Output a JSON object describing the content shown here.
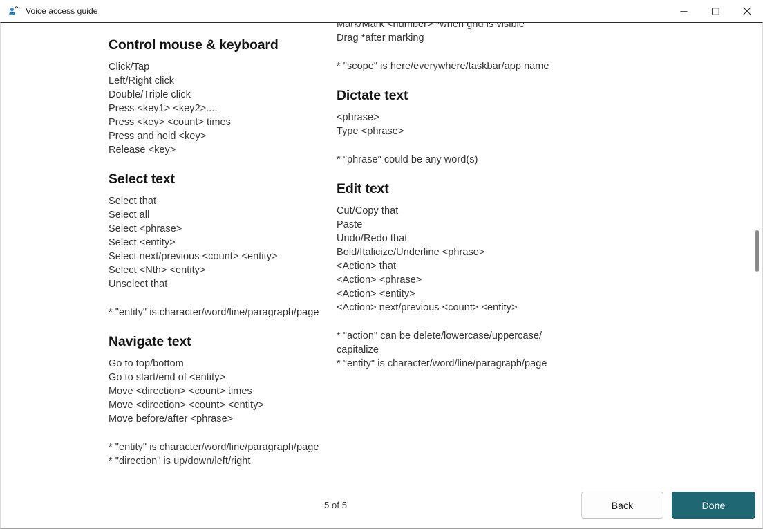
{
  "window": {
    "title": "Voice access guide",
    "icon": "voice-access-icon",
    "controls": {
      "minimize": "minimize-icon",
      "maximize": "maximize-icon",
      "close": "close-icon"
    }
  },
  "content": {
    "left_column": {
      "clipped_top_line": "",
      "sections": [
        {
          "heading": "Control mouse & keyboard",
          "items": [
            "Click/Tap",
            "Left/Right click",
            "Double/Triple click",
            "Press <key1> <key2>....",
            "Press <key> <count> times",
            "Press and hold <key>",
            "Release <key>"
          ],
          "notes": []
        },
        {
          "heading": "Select text",
          "items": [
            "Select that",
            "Select all",
            "Select <phrase>",
            "Select <entity>",
            "Select next/previous <count> <entity>",
            "Select <Nth> <entity>",
            "Unselect that"
          ],
          "notes": [
            "* \"entity\" is character/word/line/paragraph/page"
          ]
        },
        {
          "heading": "Navigate text",
          "items": [
            "Go to top/bottom",
            "Go to start/end of <entity>",
            "Move <direction> <count> times",
            "Move <direction> <count> <entity>",
            "Move before/after <phrase>"
          ],
          "notes": [
            "* \"entity\" is character/word/line/paragraph/page",
            "* \"direction\" is up/down/left/right"
          ]
        }
      ]
    },
    "right_column": {
      "clipped_top_line": "",
      "continued_items": [
        "Mark/Mark <number> *when grid is visible",
        "Drag *after marking"
      ],
      "continued_notes": [
        "* \"scope\" is here/everywhere/taskbar/app name"
      ],
      "sections": [
        {
          "heading": "Dictate text",
          "items": [
            "<phrase>",
            "Type <phrase>"
          ],
          "notes": [
            "* \"phrase\" could be any word(s)"
          ]
        },
        {
          "heading": "Edit text",
          "items": [
            "Cut/Copy that",
            "Paste",
            "Undo/Redo that",
            "Bold/Italicize/Underline <phrase>",
            "<Action> that",
            "<Action> <phrase>",
            "<Action> <entity>",
            "<Action> next/previous <count> <entity>"
          ],
          "notes": [
            "* \"action\" can be delete/lowercase/uppercase/",
            "capitalize",
            "* \"entity\" is character/word/line/paragraph/page"
          ]
        }
      ]
    }
  },
  "footer": {
    "page_indicator": "5 of 5",
    "back_label": "Back",
    "done_label": "Done"
  },
  "colors": {
    "accent": "#1e6773",
    "text": "#353535",
    "heading": "#141414"
  }
}
